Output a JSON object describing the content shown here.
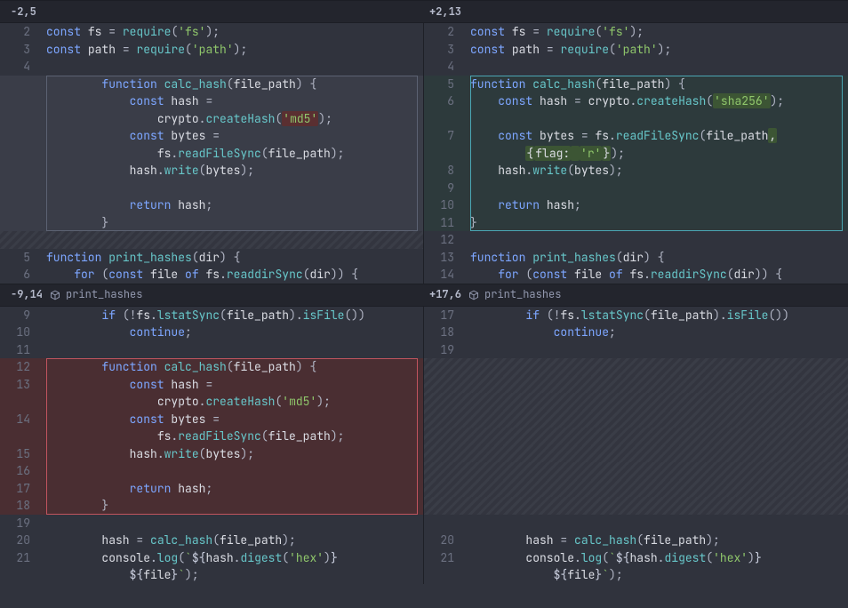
{
  "hunk1": {
    "left_label": "-2,5",
    "right_label": "+2,13"
  },
  "hunk2": {
    "left_label": "-9,14",
    "right_label": "+17,6",
    "context_fn": "print_hashes"
  },
  "left1": {
    "l2": {
      "n": "2",
      "pre": "",
      "tokens": [
        [
          "kw",
          "const"
        ],
        [
          "",
          ""
        ],
        [
          "id",
          " fs"
        ],
        [
          "op",
          " = "
        ],
        [
          "fn",
          "require"
        ],
        [
          "punc",
          "("
        ],
        [
          "str",
          "'fs'"
        ],
        [
          "punc",
          ");"
        ]
      ]
    },
    "l3": {
      "n": "3",
      "pre": "",
      "tokens": [
        [
          "kw",
          "const"
        ],
        [
          "id",
          " path"
        ],
        [
          "op",
          " = "
        ],
        [
          "fn",
          "require"
        ],
        [
          "punc",
          "("
        ],
        [
          "str",
          "'path'"
        ],
        [
          "punc",
          ");"
        ]
      ]
    },
    "l4": {
      "n": "4",
      "pre": "",
      "tokens": []
    },
    "mv": [
      {
        "n": "",
        "pre": "        ",
        "tokens": [
          [
            "kw",
            "function"
          ],
          [
            "fn",
            " calc_hash"
          ],
          [
            "punc",
            "("
          ],
          [
            "id",
            "file_path"
          ],
          [
            "punc",
            ") {"
          ]
        ]
      },
      {
        "n": "",
        "pre": "            ",
        "tokens": [
          [
            "kw",
            "const"
          ],
          [
            "id",
            " hash"
          ],
          [
            "op",
            " ="
          ]
        ]
      },
      {
        "n": "",
        "pre": "                ",
        "tokens": [
          [
            "id",
            "crypto"
          ],
          [
            "punc",
            "."
          ],
          [
            "fn",
            "createHash"
          ],
          [
            "punc",
            "("
          ],
          [
            "hl-red",
            "'md5'"
          ],
          [
            "punc",
            ");"
          ]
        ]
      },
      {
        "n": "",
        "pre": "            ",
        "tokens": [
          [
            "kw",
            "const"
          ],
          [
            "id",
            " bytes"
          ],
          [
            "op",
            " ="
          ]
        ]
      },
      {
        "n": "",
        "pre": "                ",
        "tokens": [
          [
            "id",
            "fs"
          ],
          [
            "punc",
            "."
          ],
          [
            "fn",
            "readFileSync"
          ],
          [
            "punc",
            "("
          ],
          [
            "id",
            "file_path"
          ],
          [
            "punc",
            ");"
          ]
        ]
      },
      {
        "n": "",
        "pre": "            ",
        "tokens": [
          [
            "id",
            "hash"
          ],
          [
            "punc",
            "."
          ],
          [
            "fn",
            "write"
          ],
          [
            "punc",
            "("
          ],
          [
            "id",
            "bytes"
          ],
          [
            "punc",
            ");"
          ]
        ]
      },
      {
        "n": "",
        "pre": "",
        "tokens": []
      },
      {
        "n": "",
        "pre": "            ",
        "tokens": [
          [
            "kw",
            "return"
          ],
          [
            "id",
            " hash"
          ],
          [
            "punc",
            ";"
          ]
        ]
      },
      {
        "n": "",
        "pre": "        ",
        "tokens": [
          [
            "punc",
            "}"
          ]
        ]
      }
    ],
    "l5": {
      "n": "5",
      "pre": "",
      "tokens": [
        [
          "kw",
          "function"
        ],
        [
          "fn",
          " print_hashes"
        ],
        [
          "punc",
          "("
        ],
        [
          "id",
          "dir"
        ],
        [
          "punc",
          ") {"
        ]
      ]
    },
    "l6": {
      "n": "6",
      "pre": "    ",
      "tokens": [
        [
          "kw",
          "for"
        ],
        [
          "punc",
          " ("
        ],
        [
          "kw",
          "const"
        ],
        [
          "id",
          " file"
        ],
        [
          "kw",
          " of "
        ],
        [
          "id",
          "fs"
        ],
        [
          "punc",
          "."
        ],
        [
          "fn",
          "readdirSync"
        ],
        [
          "punc",
          "("
        ],
        [
          "id",
          "dir"
        ],
        [
          "punc",
          ")) {"
        ]
      ]
    }
  },
  "right1": {
    "l2": {
      "n": "2",
      "pre": "",
      "tokens": [
        [
          "kw",
          "const"
        ],
        [
          "id",
          " fs"
        ],
        [
          "op",
          " = "
        ],
        [
          "fn",
          "require"
        ],
        [
          "punc",
          "("
        ],
        [
          "str",
          "'fs'"
        ],
        [
          "punc",
          ");"
        ]
      ]
    },
    "l3": {
      "n": "3",
      "pre": "",
      "tokens": [
        [
          "kw",
          "const"
        ],
        [
          "id",
          " path"
        ],
        [
          "op",
          " = "
        ],
        [
          "fn",
          "require"
        ],
        [
          "punc",
          "("
        ],
        [
          "str",
          "'path'"
        ],
        [
          "punc",
          ");"
        ]
      ]
    },
    "l4": {
      "n": "4",
      "pre": "",
      "tokens": []
    },
    "mv": [
      {
        "n": "5",
        "pre": "",
        "tokens": [
          [
            "kw",
            "function"
          ],
          [
            "fn",
            " calc_hash"
          ],
          [
            "punc",
            "("
          ],
          [
            "id",
            "file_path"
          ],
          [
            "punc",
            ") {"
          ]
        ]
      },
      {
        "n": "6",
        "pre": "    ",
        "tokens": [
          [
            "kw",
            "const"
          ],
          [
            "id",
            " hash"
          ],
          [
            "op",
            " = "
          ],
          [
            "id",
            "crypto"
          ],
          [
            "punc",
            "."
          ],
          [
            "fn",
            "createHash"
          ],
          [
            "punc",
            "("
          ],
          [
            "hl-grn",
            "'sha256'"
          ],
          [
            "punc",
            ");"
          ]
        ]
      },
      {
        "n": "",
        "pre": "",
        "tokens": []
      },
      {
        "n": "7",
        "pre": "    ",
        "tokens": [
          [
            "kw",
            "const"
          ],
          [
            "id",
            " bytes"
          ],
          [
            "op",
            " = "
          ],
          [
            "id",
            "fs"
          ],
          [
            "punc",
            "."
          ],
          [
            "fn",
            "readFileSync"
          ],
          [
            "punc",
            "("
          ],
          [
            "id",
            "file_path"
          ],
          [
            "hl-grn-sub",
            ","
          ]
        ]
      },
      {
        "n": "",
        "pre": "        ",
        "tokens": [
          [
            "hl-grn-sub",
            "{"
          ],
          [
            "hl-flag",
            "flag:"
          ],
          [
            "hl-grn-sub",
            " "
          ],
          [
            "hl-grn",
            "'r'"
          ],
          [
            "hl-grn-sub",
            "}"
          ],
          [
            "punc",
            ");"
          ]
        ]
      },
      {
        "n": "8",
        "pre": "    ",
        "tokens": [
          [
            "id",
            "hash"
          ],
          [
            "punc",
            "."
          ],
          [
            "fn",
            "write"
          ],
          [
            "punc",
            "("
          ],
          [
            "id",
            "bytes"
          ],
          [
            "punc",
            ");"
          ]
        ]
      },
      {
        "n": "9",
        "pre": "",
        "tokens": []
      },
      {
        "n": "10",
        "pre": "    ",
        "tokens": [
          [
            "kw",
            "return"
          ],
          [
            "id",
            " hash"
          ],
          [
            "punc",
            ";"
          ]
        ]
      },
      {
        "n": "11",
        "pre": "",
        "tokens": [
          [
            "punc",
            "}"
          ]
        ]
      }
    ],
    "l12": {
      "n": "12",
      "pre": "",
      "tokens": []
    },
    "l13": {
      "n": "13",
      "pre": "",
      "tokens": [
        [
          "kw",
          "function"
        ],
        [
          "fn",
          " print_hashes"
        ],
        [
          "punc",
          "("
        ],
        [
          "id",
          "dir"
        ],
        [
          "punc",
          ") {"
        ]
      ]
    },
    "l14": {
      "n": "14",
      "pre": "    ",
      "tokens": [
        [
          "kw",
          "for"
        ],
        [
          "punc",
          " ("
        ],
        [
          "kw",
          "const"
        ],
        [
          "id",
          " file"
        ],
        [
          "kw",
          " of "
        ],
        [
          "id",
          "fs"
        ],
        [
          "punc",
          "."
        ],
        [
          "fn",
          "readdirSync"
        ],
        [
          "punc",
          "("
        ],
        [
          "id",
          "dir"
        ],
        [
          "punc",
          ")) {"
        ]
      ]
    }
  },
  "left2": {
    "l9": {
      "n": "9",
      "pre": "        ",
      "tokens": [
        [
          "kw",
          "if"
        ],
        [
          "punc",
          " (!"
        ],
        [
          "id",
          "fs"
        ],
        [
          "punc",
          "."
        ],
        [
          "fn",
          "lstatSync"
        ],
        [
          "punc",
          "("
        ],
        [
          "id",
          "file_path"
        ],
        [
          "punc",
          ")."
        ],
        [
          "fn",
          "isFile"
        ],
        [
          "punc",
          "())"
        ]
      ]
    },
    "l10": {
      "n": "10",
      "pre": "            ",
      "tokens": [
        [
          "kw",
          "continue"
        ],
        [
          "punc",
          ";"
        ]
      ]
    },
    "l11": {
      "n": "11",
      "pre": "",
      "tokens": []
    },
    "del": [
      {
        "n": "12",
        "pre": "        ",
        "tokens": [
          [
            "kw",
            "function"
          ],
          [
            "fn",
            " calc_hash"
          ],
          [
            "punc",
            "("
          ],
          [
            "id",
            "file_path"
          ],
          [
            "punc",
            ") {"
          ]
        ]
      },
      {
        "n": "13",
        "pre": "            ",
        "tokens": [
          [
            "kw",
            "const"
          ],
          [
            "id",
            " hash"
          ],
          [
            "op",
            " ="
          ]
        ]
      },
      {
        "n": "",
        "pre": "                ",
        "tokens": [
          [
            "id",
            "crypto"
          ],
          [
            "punc",
            "."
          ],
          [
            "fn",
            "createHash"
          ],
          [
            "punc",
            "("
          ],
          [
            "str",
            "'md5'"
          ],
          [
            "punc",
            ");"
          ]
        ]
      },
      {
        "n": "14",
        "pre": "            ",
        "tokens": [
          [
            "kw",
            "const"
          ],
          [
            "id",
            " bytes"
          ],
          [
            "op",
            " ="
          ]
        ]
      },
      {
        "n": "",
        "pre": "                ",
        "tokens": [
          [
            "id",
            "fs"
          ],
          [
            "punc",
            "."
          ],
          [
            "fn",
            "readFileSync"
          ],
          [
            "punc",
            "("
          ],
          [
            "id",
            "file_path"
          ],
          [
            "punc",
            ");"
          ]
        ]
      },
      {
        "n": "15",
        "pre": "            ",
        "tokens": [
          [
            "id",
            "hash"
          ],
          [
            "punc",
            "."
          ],
          [
            "fn",
            "write"
          ],
          [
            "punc",
            "("
          ],
          [
            "id",
            "bytes"
          ],
          [
            "punc",
            ");"
          ]
        ]
      },
      {
        "n": "16",
        "pre": "",
        "tokens": []
      },
      {
        "n": "17",
        "pre": "            ",
        "tokens": [
          [
            "kw",
            "return"
          ],
          [
            "id",
            " hash"
          ],
          [
            "punc",
            ";"
          ]
        ]
      },
      {
        "n": "18",
        "pre": "        ",
        "tokens": [
          [
            "punc",
            "}"
          ]
        ]
      }
    ],
    "l19": {
      "n": "19",
      "pre": "",
      "tokens": []
    },
    "l20": {
      "n": "20",
      "pre": "        ",
      "tokens": [
        [
          "id",
          "hash"
        ],
        [
          "op",
          " = "
        ],
        [
          "fn",
          "calc_hash"
        ],
        [
          "punc",
          "("
        ],
        [
          "id",
          "file_path"
        ],
        [
          "punc",
          ");"
        ]
      ]
    },
    "l21a": {
      "n": "21",
      "pre": "        ",
      "tokens": [
        [
          "id",
          "console"
        ],
        [
          "punc",
          "."
        ],
        [
          "fn",
          "log"
        ],
        [
          "punc",
          "("
        ],
        [
          "tmpl",
          "`"
        ],
        [
          "tmplerp",
          "${"
        ],
        [
          "id",
          "hash"
        ],
        [
          "punc",
          "."
        ],
        [
          "fn",
          "digest"
        ],
        [
          "punc",
          "("
        ],
        [
          "str",
          "'hex'"
        ],
        [
          "punc",
          ")"
        ],
        [
          "tmplerp",
          "}"
        ]
      ]
    },
    "l21b": {
      "n": "",
      "pre": "            ",
      "tokens": [
        [
          "tmplerp",
          "${"
        ],
        [
          "id",
          "file"
        ],
        [
          "tmplerp",
          "}"
        ],
        [
          "tmpl",
          "`"
        ],
        [
          "punc",
          ");"
        ]
      ]
    }
  },
  "right2": {
    "l17": {
      "n": "17",
      "pre": "        ",
      "tokens": [
        [
          "kw",
          "if"
        ],
        [
          "punc",
          " (!"
        ],
        [
          "id",
          "fs"
        ],
        [
          "punc",
          "."
        ],
        [
          "fn",
          "lstatSync"
        ],
        [
          "punc",
          "("
        ],
        [
          "id",
          "file_path"
        ],
        [
          "punc",
          ")."
        ],
        [
          "fn",
          "isFile"
        ],
        [
          "punc",
          "())"
        ]
      ]
    },
    "l18": {
      "n": "18",
      "pre": "            ",
      "tokens": [
        [
          "kw",
          "continue"
        ],
        [
          "punc",
          ";"
        ]
      ]
    },
    "l19": {
      "n": "19",
      "pre": "",
      "tokens": []
    },
    "l20": {
      "n": "20",
      "pre": "        ",
      "tokens": [
        [
          "id",
          "hash"
        ],
        [
          "op",
          " = "
        ],
        [
          "fn",
          "calc_hash"
        ],
        [
          "punc",
          "("
        ],
        [
          "id",
          "file_path"
        ],
        [
          "punc",
          ");"
        ]
      ]
    },
    "l21a": {
      "n": "21",
      "pre": "        ",
      "tokens": [
        [
          "id",
          "console"
        ],
        [
          "punc",
          "."
        ],
        [
          "fn",
          "log"
        ],
        [
          "punc",
          "("
        ],
        [
          "tmpl",
          "`"
        ],
        [
          "tmplerp",
          "${"
        ],
        [
          "id",
          "hash"
        ],
        [
          "punc",
          "."
        ],
        [
          "fn",
          "digest"
        ],
        [
          "punc",
          "("
        ],
        [
          "str",
          "'hex'"
        ],
        [
          "punc",
          ")"
        ],
        [
          "tmplerp",
          "}"
        ]
      ]
    },
    "l21b": {
      "n": "",
      "pre": "            ",
      "tokens": [
        [
          "tmplerp",
          "${"
        ],
        [
          "id",
          "file"
        ],
        [
          "tmplerp",
          "}"
        ],
        [
          "tmpl",
          "`"
        ],
        [
          "punc",
          ");"
        ]
      ]
    }
  }
}
